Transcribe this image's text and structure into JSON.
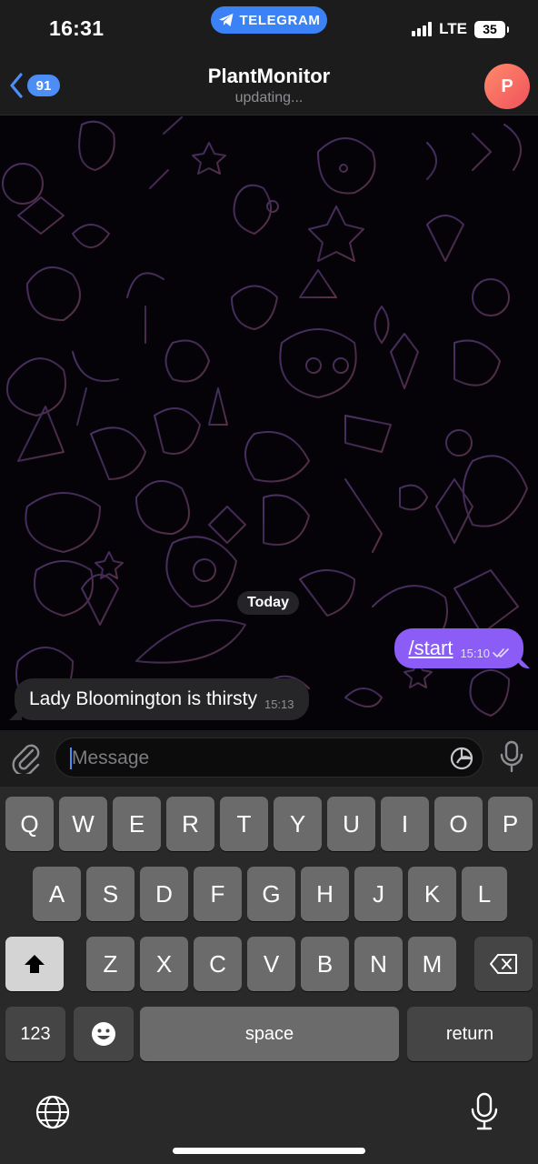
{
  "status_bar": {
    "time": "16:31",
    "app_pill": "TELEGRAM",
    "network": "LTE",
    "battery": "35"
  },
  "header": {
    "back_count": "91",
    "title": "PlantMonitor",
    "subtitle": "updating...",
    "avatar_letter": "P",
    "accent": "#4c8df6"
  },
  "chat": {
    "date_separator": "Today",
    "messages": [
      {
        "direction": "outgoing",
        "text": "/start",
        "time": "15:10",
        "status": "read",
        "bubble_color": "#8b5cf6"
      },
      {
        "direction": "incoming",
        "text": "Lady Bloomington is thirsty",
        "time": "15:13",
        "bubble_color": "#262628"
      }
    ]
  },
  "composer": {
    "placeholder": "Message",
    "value": ""
  },
  "keyboard": {
    "row1": [
      "Q",
      "W",
      "E",
      "R",
      "T",
      "Y",
      "U",
      "I",
      "O",
      "P"
    ],
    "row2": [
      "A",
      "S",
      "D",
      "F",
      "G",
      "H",
      "J",
      "K",
      "L"
    ],
    "row3": [
      "Z",
      "X",
      "C",
      "V",
      "B",
      "N",
      "M"
    ],
    "numbers_label": "123",
    "space_label": "space",
    "return_label": "return"
  }
}
